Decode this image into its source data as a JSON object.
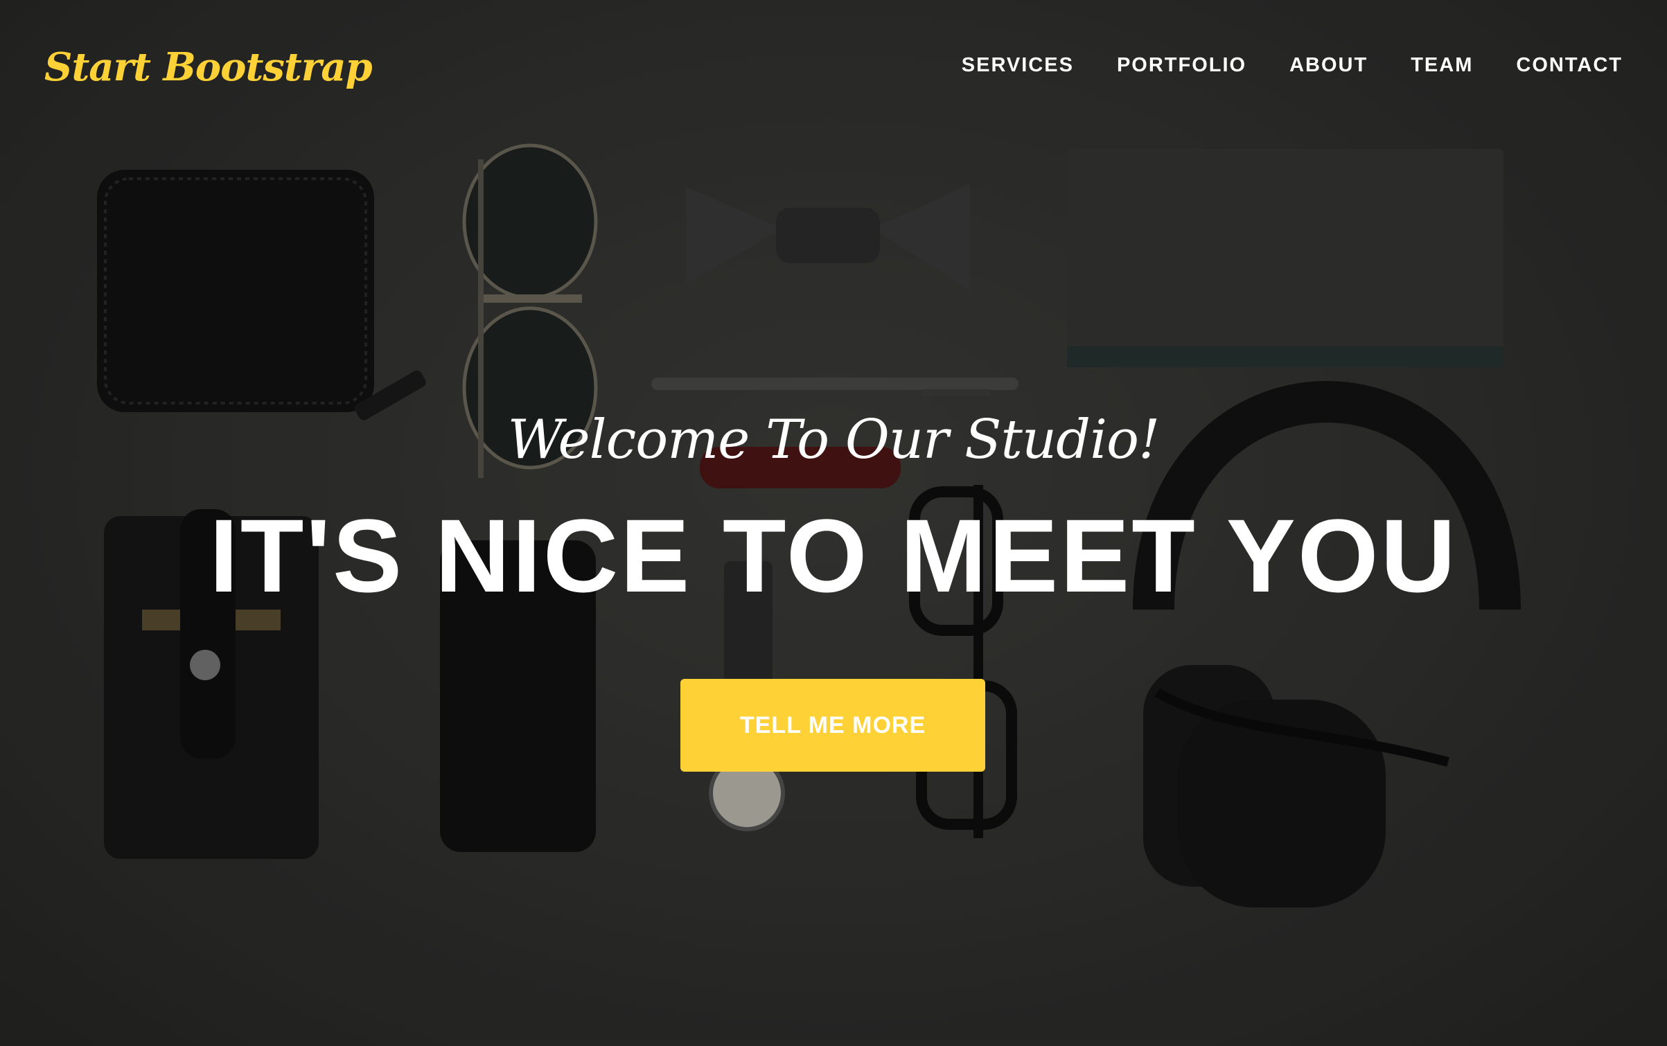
{
  "navbar": {
    "brand": "Start Bootstrap",
    "items": [
      {
        "label": "SERVICES"
      },
      {
        "label": "PORTFOLIO"
      },
      {
        "label": "ABOUT"
      },
      {
        "label": "TEAM"
      },
      {
        "label": "CONTACT"
      }
    ]
  },
  "hero": {
    "subheading": "Welcome To Our Studio!",
    "heading": "IT'S NICE TO MEET YOU",
    "button_label": "TELL ME MORE"
  },
  "colors": {
    "accent": "#fed136",
    "background": "#333331",
    "text": "#ffffff"
  }
}
